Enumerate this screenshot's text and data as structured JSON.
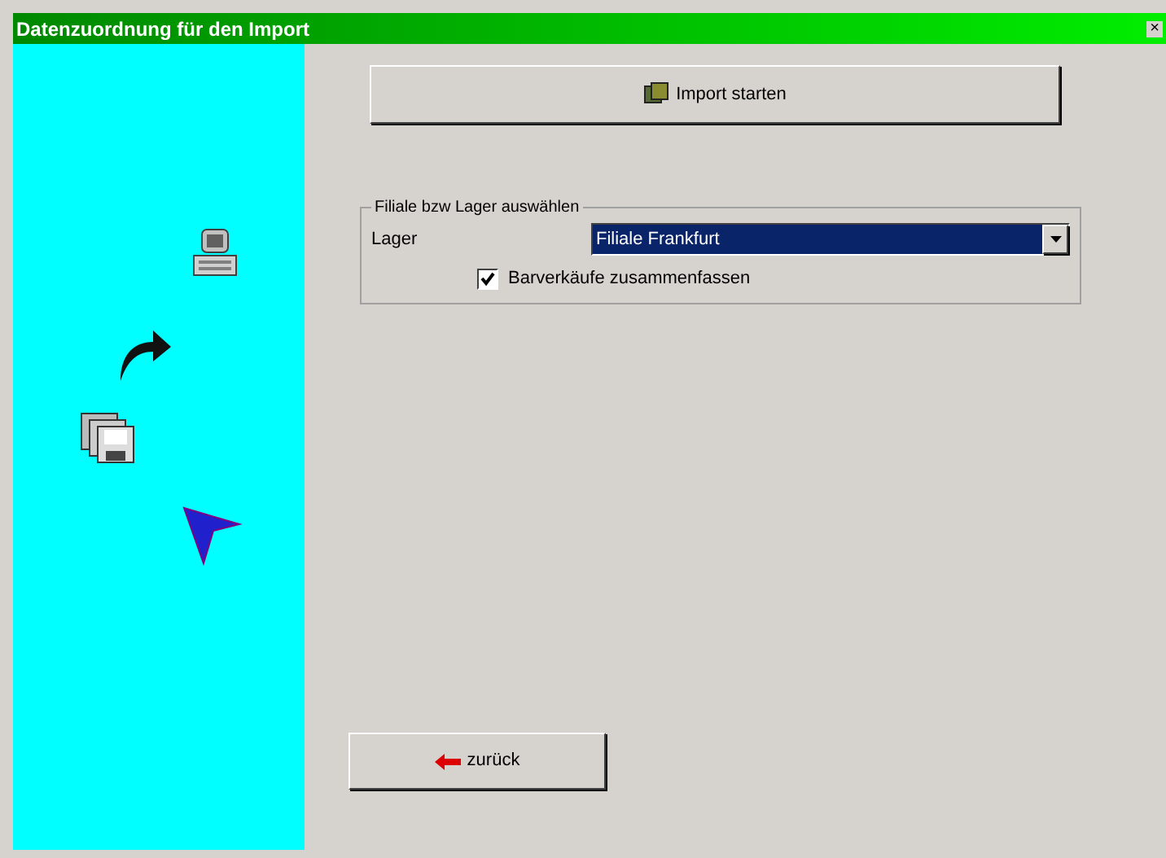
{
  "window": {
    "title": "Datenzuordnung für den Import",
    "close": "×"
  },
  "import_button": {
    "label": "Import starten"
  },
  "group": {
    "title": "Filiale bzw Lager auswählen",
    "field_label": "Lager",
    "dropdown": {
      "value": "Filiale Frankfurt",
      "selected": true
    },
    "checkbox": {
      "label": "Barverkäufe zusammenfassen",
      "checked": true
    }
  },
  "back_button": {
    "label": "zurück"
  }
}
